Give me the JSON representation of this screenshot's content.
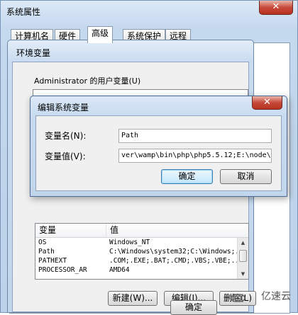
{
  "outer_window": {
    "title": "系统属性",
    "close_glyph": "✕",
    "tabs": [
      "计算机名",
      "硬件",
      "高级",
      "系统保护",
      "远程"
    ],
    "ok_label": "确定"
  },
  "env_window": {
    "title": "环境变量",
    "user_group_label": "Administrator 的用户变量(U)",
    "system_list": {
      "headers": [
        "变量",
        "值"
      ],
      "rows": [
        {
          "name": "OS",
          "value": "Windows_NT"
        },
        {
          "name": "Path",
          "value": "C:\\Windows\\system32;C:\\Windows;..."
        },
        {
          "name": "PATHEXT",
          "value": ".COM;.EXE;.BAT;.CMD;.VBS;.VBE;..."
        },
        {
          "name": "PROCESSOR_AR",
          "value": "AMD64"
        }
      ]
    },
    "buttons": {
      "new": "新建(W)...",
      "edit": "编辑(I)...",
      "delete": "删除(L)"
    }
  },
  "edit_dialog": {
    "title": "编辑系统变量",
    "close_glyph": "✕",
    "name_label": "变量名(N):",
    "name_value": "Path",
    "value_label": "变量值(V):",
    "value_value": "ver\\wamp\\bin\\php\\php5.5.12;E:\\node\\",
    "ok_label": "确定",
    "cancel_label": "取消"
  },
  "watermark": {
    "text": "亿速云"
  },
  "colors": {
    "accent": "#3c7fb1",
    "close": "#c7493a",
    "title_bar": "#c7daef"
  }
}
